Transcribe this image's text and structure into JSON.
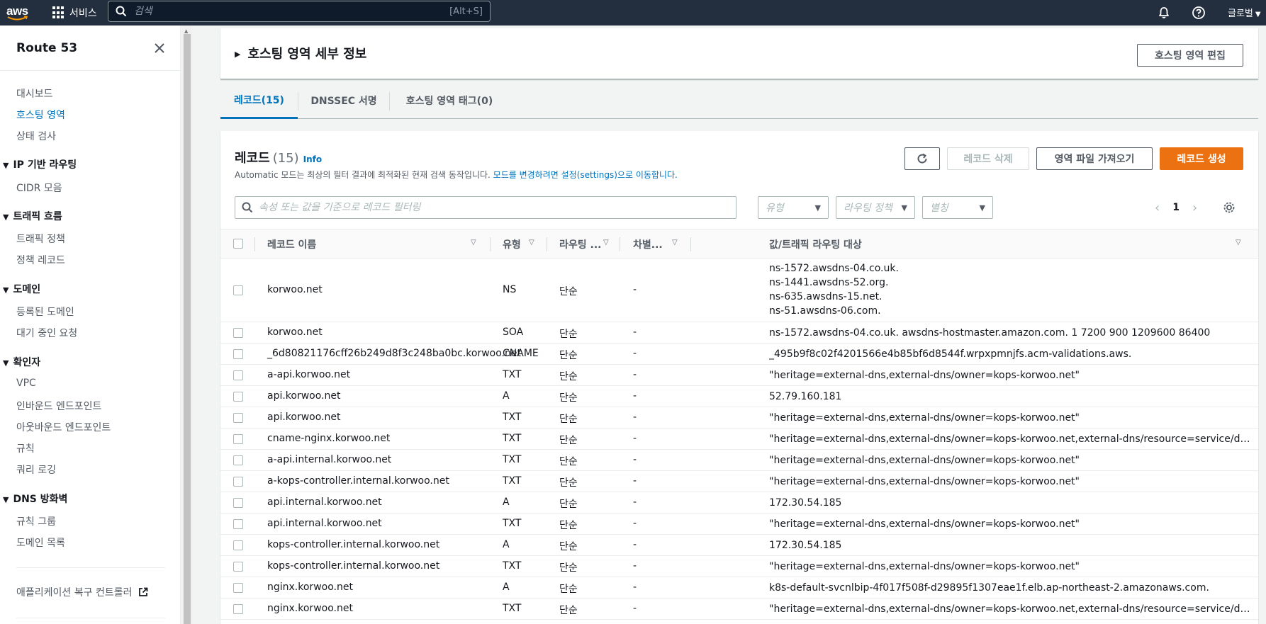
{
  "nav": {
    "logo_text": "aws",
    "services_label": "서비스",
    "search_placeholder": "검색",
    "search_shortcut": "[Alt+S]",
    "region_label": "글로벌"
  },
  "sidebar": {
    "title": "Route 53",
    "items_top": [
      "대시보드",
      "호스팅 영역",
      "상태 검사"
    ],
    "sections": [
      {
        "title": "IP 기반 라우팅",
        "items": [
          "CIDR 모음"
        ]
      },
      {
        "title": "트래픽 흐름",
        "items": [
          "트래픽 정책",
          "정책 레코드"
        ]
      },
      {
        "title": "도메인",
        "items": [
          "등록된 도메인",
          "대기 중인 요청"
        ]
      },
      {
        "title": "확인자",
        "items": [
          "VPC",
          "인바운드 엔드포인트",
          "아웃바운드 엔드포인트",
          "규칙",
          "쿼리 로깅"
        ]
      },
      {
        "title": "DNS 방화벽",
        "items": [
          "규칙 그룹",
          "도메인 목록"
        ]
      }
    ],
    "footer_link": "애플리케이션 복구 컨트롤러"
  },
  "hosted_zone": {
    "details_title": "호스팅 영역 세부 정보",
    "edit_button": "호스팅 영역 편집"
  },
  "tabs": [
    "레코드(15)",
    "DNSSEC 서명",
    "호스팅 영역 태그(0)"
  ],
  "records": {
    "title": "레코드",
    "count": "(15)",
    "info": "Info",
    "desc_text": "Automatic 모드는 최상의 필터 결과에 최적화된 현재 검색 동작입니다.",
    "desc_link": "모드를 변경하려면 설정(settings)으로 이동합니다.",
    "delete_button": "레코드 삭제",
    "import_button": "영역 파일 가져오기",
    "create_button": "레코드 생성",
    "filter_placeholder": "속성 또는 값을 기준으로 레코드 필터링",
    "filter_type": "유형",
    "filter_routing": "라우팅 정책",
    "filter_alias": "별칭",
    "page": "1",
    "columns": [
      "레코드 이름",
      "유형",
      "라우팅 ...",
      "차별...",
      "값/트래픽 라우팅 대상"
    ],
    "rows": [
      {
        "name": "korwoo.net",
        "type": "NS",
        "routing": "단순",
        "diff": "-",
        "values": [
          "ns-1572.awsdns-04.co.uk.",
          "ns-1441.awsdns-52.org.",
          "ns-635.awsdns-15.net.",
          "ns-51.awsdns-06.com."
        ]
      },
      {
        "name": "korwoo.net",
        "type": "SOA",
        "routing": "단순",
        "diff": "-",
        "values": [
          "ns-1572.awsdns-04.co.uk. awsdns-hostmaster.amazon.com. 1 7200 900 1209600 86400"
        ]
      },
      {
        "name": "_6d80821176cff26b249d8f3c248ba0bc.korwoo.net",
        "type": "CNAME",
        "routing": "단순",
        "diff": "-",
        "values": [
          "_495b9f8c02f4201566e4b85bf6d8544f.wrpxpmnjfs.acm-validations.aws."
        ]
      },
      {
        "name": "a-api.korwoo.net",
        "type": "TXT",
        "routing": "단순",
        "diff": "-",
        "values": [
          "\"heritage=external-dns,external-dns/owner=kops-korwoo.net\""
        ]
      },
      {
        "name": "api.korwoo.net",
        "type": "A",
        "routing": "단순",
        "diff": "-",
        "values": [
          "52.79.160.181"
        ]
      },
      {
        "name": "api.korwoo.net",
        "type": "TXT",
        "routing": "단순",
        "diff": "-",
        "values": [
          "\"heritage=external-dns,external-dns/owner=kops-korwoo.net\""
        ]
      },
      {
        "name": "cname-nginx.korwoo.net",
        "type": "TXT",
        "routing": "단순",
        "diff": "-",
        "values": [
          "\"heritage=external-dns,external-dns/owner=kops-korwoo.net,external-dns/resource=service/default/svcnlb\""
        ]
      },
      {
        "name": "a-api.internal.korwoo.net",
        "type": "TXT",
        "routing": "단순",
        "diff": "-",
        "values": [
          "\"heritage=external-dns,external-dns/owner=kops-korwoo.net\""
        ]
      },
      {
        "name": "a-kops-controller.internal.korwoo.net",
        "type": "TXT",
        "routing": "단순",
        "diff": "-",
        "values": [
          "\"heritage=external-dns,external-dns/owner=kops-korwoo.net\""
        ]
      },
      {
        "name": "api.internal.korwoo.net",
        "type": "A",
        "routing": "단순",
        "diff": "-",
        "values": [
          "172.30.54.185"
        ]
      },
      {
        "name": "api.internal.korwoo.net",
        "type": "TXT",
        "routing": "단순",
        "diff": "-",
        "values": [
          "\"heritage=external-dns,external-dns/owner=kops-korwoo.net\""
        ]
      },
      {
        "name": "kops-controller.internal.korwoo.net",
        "type": "A",
        "routing": "단순",
        "diff": "-",
        "values": [
          "172.30.54.185"
        ]
      },
      {
        "name": "kops-controller.internal.korwoo.net",
        "type": "TXT",
        "routing": "단순",
        "diff": "-",
        "values": [
          "\"heritage=external-dns,external-dns/owner=kops-korwoo.net\""
        ]
      },
      {
        "name": "nginx.korwoo.net",
        "type": "A",
        "routing": "단순",
        "diff": "-",
        "values": [
          "k8s-default-svcnlbip-4f017f508f-d29895f1307eae1f.elb.ap-northeast-2.amazonaws.com."
        ]
      },
      {
        "name": "nginx.korwoo.net",
        "type": "TXT",
        "routing": "단순",
        "diff": "-",
        "values": [
          "\"heritage=external-dns,external-dns/owner=kops-korwoo.net,external-dns/resource=service/default/svcnlb\""
        ]
      }
    ]
  },
  "colors": {
    "nav_bg": "#232f3e",
    "link": "#0073bb",
    "primary": "#ec7211"
  }
}
